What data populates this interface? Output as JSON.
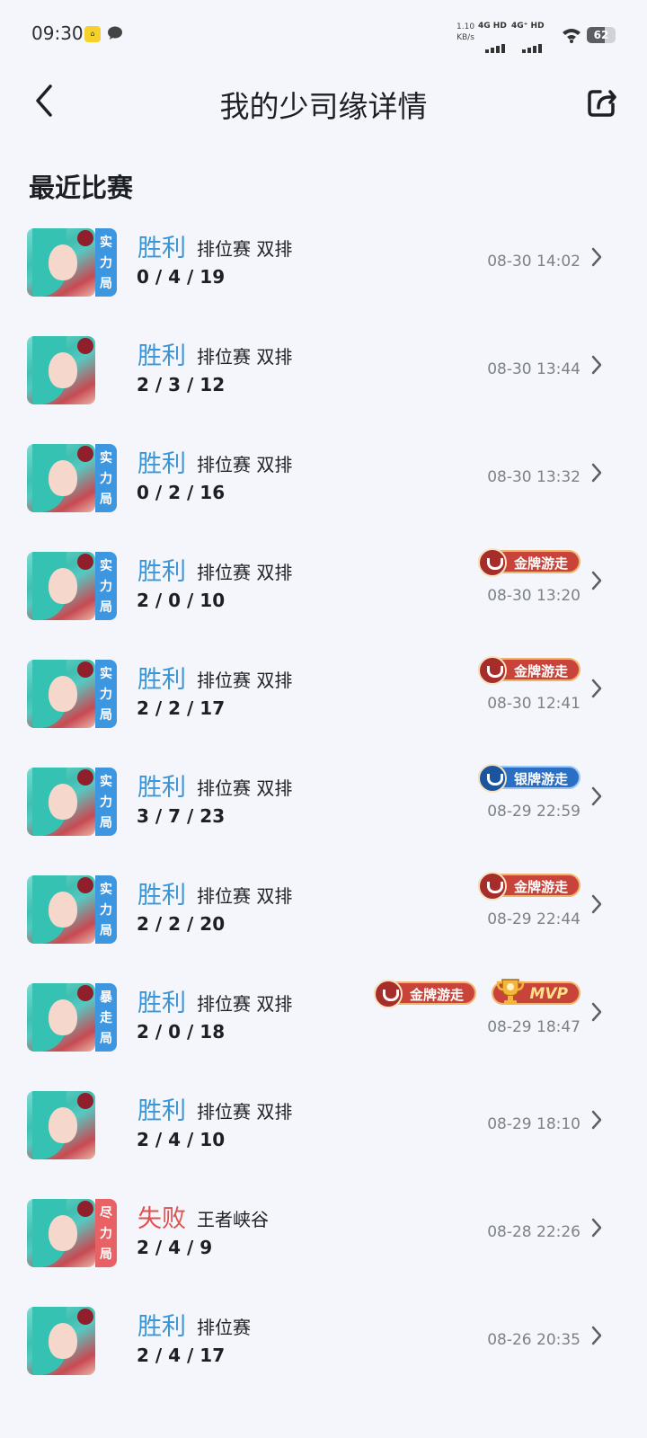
{
  "status": {
    "time": "09:30",
    "speed_top": "1.10",
    "speed_bottom": "KB/s",
    "sig1": "4G HD",
    "sig2": "4G⁺ HD",
    "battery": "62",
    "battery_level": 0.62
  },
  "header": {
    "title": "我的少司缘详情"
  },
  "section": {
    "title": "最近比赛"
  },
  "matches": [
    {
      "result": "胜利",
      "outcome": "win",
      "mode": "排位赛 双排",
      "kda": "0 / 4 / 19",
      "time": "08-30 14:02",
      "tag": [
        "实",
        "力",
        "局"
      ],
      "tag_color": "blue",
      "badges": []
    },
    {
      "result": "胜利",
      "outcome": "win",
      "mode": "排位赛 双排",
      "kda": "2 / 3 / 12",
      "time": "08-30 13:44",
      "tag": [],
      "tag_color": "",
      "badges": []
    },
    {
      "result": "胜利",
      "outcome": "win",
      "mode": "排位赛 双排",
      "kda": "0 / 2 / 16",
      "time": "08-30 13:32",
      "tag": [
        "实",
        "力",
        "局"
      ],
      "tag_color": "blue",
      "badges": []
    },
    {
      "result": "胜利",
      "outcome": "win",
      "mode": "排位赛 双排",
      "kda": "2 / 0 / 10",
      "time": "08-30 13:20",
      "tag": [
        "实",
        "力",
        "局"
      ],
      "tag_color": "blue",
      "badges": [
        {
          "label": "金牌游走",
          "kind": "gold"
        }
      ]
    },
    {
      "result": "胜利",
      "outcome": "win",
      "mode": "排位赛 双排",
      "kda": "2 / 2 / 17",
      "time": "08-30 12:41",
      "tag": [
        "实",
        "力",
        "局"
      ],
      "tag_color": "blue",
      "badges": [
        {
          "label": "金牌游走",
          "kind": "gold"
        }
      ]
    },
    {
      "result": "胜利",
      "outcome": "win",
      "mode": "排位赛 双排",
      "kda": "3 / 7 / 23",
      "time": "08-29 22:59",
      "tag": [
        "实",
        "力",
        "局"
      ],
      "tag_color": "blue",
      "badges": [
        {
          "label": "银牌游走",
          "kind": "silver"
        }
      ]
    },
    {
      "result": "胜利",
      "outcome": "win",
      "mode": "排位赛 双排",
      "kda": "2 / 2 / 20",
      "time": "08-29 22:44",
      "tag": [
        "实",
        "力",
        "局"
      ],
      "tag_color": "blue",
      "badges": [
        {
          "label": "金牌游走",
          "kind": "gold"
        }
      ]
    },
    {
      "result": "胜利",
      "outcome": "win",
      "mode": "排位赛 双排",
      "kda": "2 / 0 / 18",
      "time": "08-29 18:47",
      "tag": [
        "暴",
        "走",
        "局"
      ],
      "tag_color": "blue",
      "badges": [
        {
          "label": "金牌游走",
          "kind": "gold"
        },
        {
          "label": "MVP",
          "kind": "mvp"
        }
      ]
    },
    {
      "result": "胜利",
      "outcome": "win",
      "mode": "排位赛 双排",
      "kda": "2 / 4 / 10",
      "time": "08-29 18:10",
      "tag": [],
      "tag_color": "",
      "badges": []
    },
    {
      "result": "失败",
      "outcome": "lose",
      "mode": "王者峡谷",
      "kda": "2 / 4 / 9",
      "time": "08-28 22:26",
      "tag": [
        "尽",
        "力",
        "局"
      ],
      "tag_color": "red",
      "badges": []
    },
    {
      "result": "胜利",
      "outcome": "win",
      "mode": "排位赛",
      "kda": "2 / 4 / 17",
      "time": "08-26 20:35",
      "tag": [],
      "tag_color": "",
      "badges": []
    }
  ]
}
